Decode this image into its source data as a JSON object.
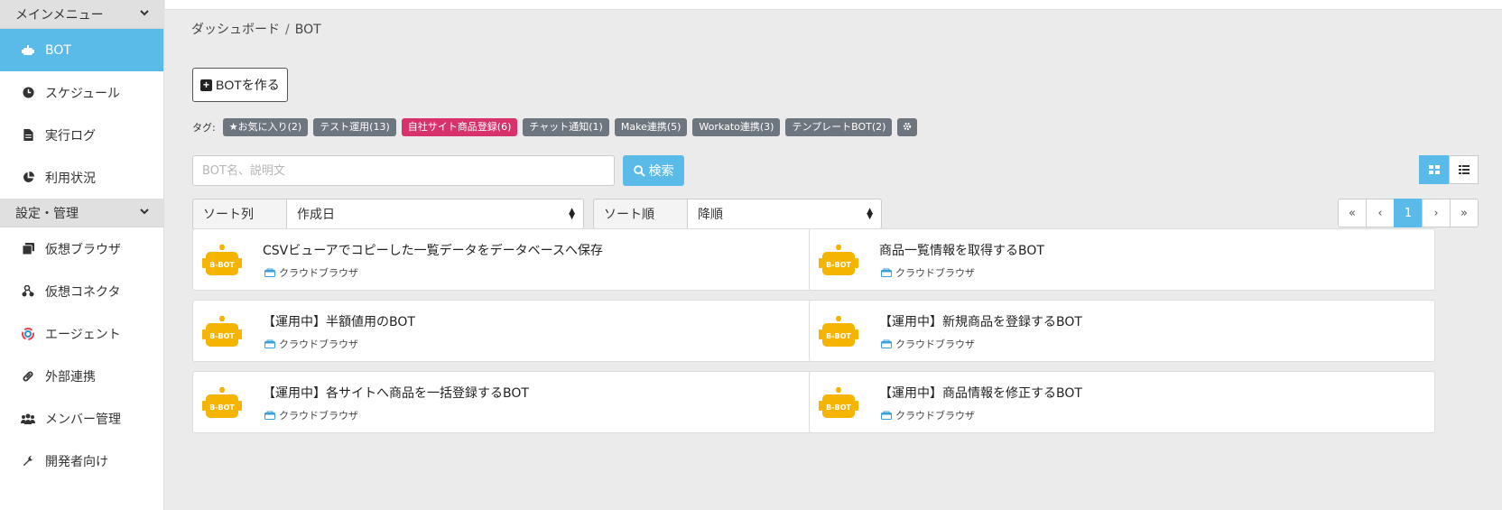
{
  "sidebar": {
    "main_header": "メインメニュー",
    "main_items": [
      {
        "label": "BOT",
        "icon": "robot-icon",
        "active": true
      },
      {
        "label": "スケジュール",
        "icon": "clock-icon"
      },
      {
        "label": "実行ログ",
        "icon": "file-icon"
      },
      {
        "label": "利用状況",
        "icon": "pie-chart-icon"
      }
    ],
    "settings_header": "設定・管理",
    "settings_items": [
      {
        "label": "仮想ブラウザ",
        "icon": "browser-icon"
      },
      {
        "label": "仮想コネクタ",
        "icon": "connector-icon"
      },
      {
        "label": "エージェント",
        "icon": "agent-icon"
      },
      {
        "label": "外部連携",
        "icon": "link-icon"
      },
      {
        "label": "メンバー管理",
        "icon": "users-icon"
      },
      {
        "label": "開発者向け",
        "icon": "wrench-icon"
      }
    ]
  },
  "breadcrumb": {
    "home": "ダッシュボード",
    "sep": "/",
    "current": "BOT"
  },
  "create_button": "BOTを作る",
  "tags": {
    "label": "タグ:",
    "items": [
      {
        "label": "お気に入り(2)",
        "color": "#6d767e",
        "star": true
      },
      {
        "label": "テスト運用(13)",
        "color": "#6d767e"
      },
      {
        "label": "自社サイト商品登録(6)",
        "color": "#d8326c"
      },
      {
        "label": "チャット通知(1)",
        "color": "#6d767e"
      },
      {
        "label": "Make連携(5)",
        "color": "#6d767e"
      },
      {
        "label": "Workato連携(3)",
        "color": "#6d767e"
      },
      {
        "label": "テンプレートBOT(2)",
        "color": "#6d767e"
      }
    ]
  },
  "search": {
    "placeholder": "BOT名、説明文",
    "button": "検索"
  },
  "sort": {
    "column_label": "ソート列",
    "column_value": "作成日",
    "order_label": "ソート順",
    "order_value": "降順"
  },
  "pagination": {
    "current": "1"
  },
  "logo_text": "B-BOT",
  "bots": [
    {
      "title": "CSVビューアでコピーした一覧データをデータベースへ保存",
      "type": "クラウドブラウザ"
    },
    {
      "title": "商品一覧情報を取得するBOT",
      "type": "クラウドブラウザ"
    },
    {
      "title": "【運用中】半額値用のBOT",
      "type": "クラウドブラウザ"
    },
    {
      "title": "【運用中】新規商品を登録するBOT",
      "type": "クラウドブラウザ"
    },
    {
      "title": "【運用中】各サイトへ商品を一括登録するBOT",
      "type": "クラウドブラウザ"
    },
    {
      "title": "【運用中】商品情報を修正するBOT",
      "type": "クラウドブラウザ"
    }
  ],
  "colors": {
    "accent": "#5bbbe8",
    "tag_pink": "#d8326c",
    "tag_gray": "#6d767e",
    "logo_yellow": "#f5b400"
  }
}
